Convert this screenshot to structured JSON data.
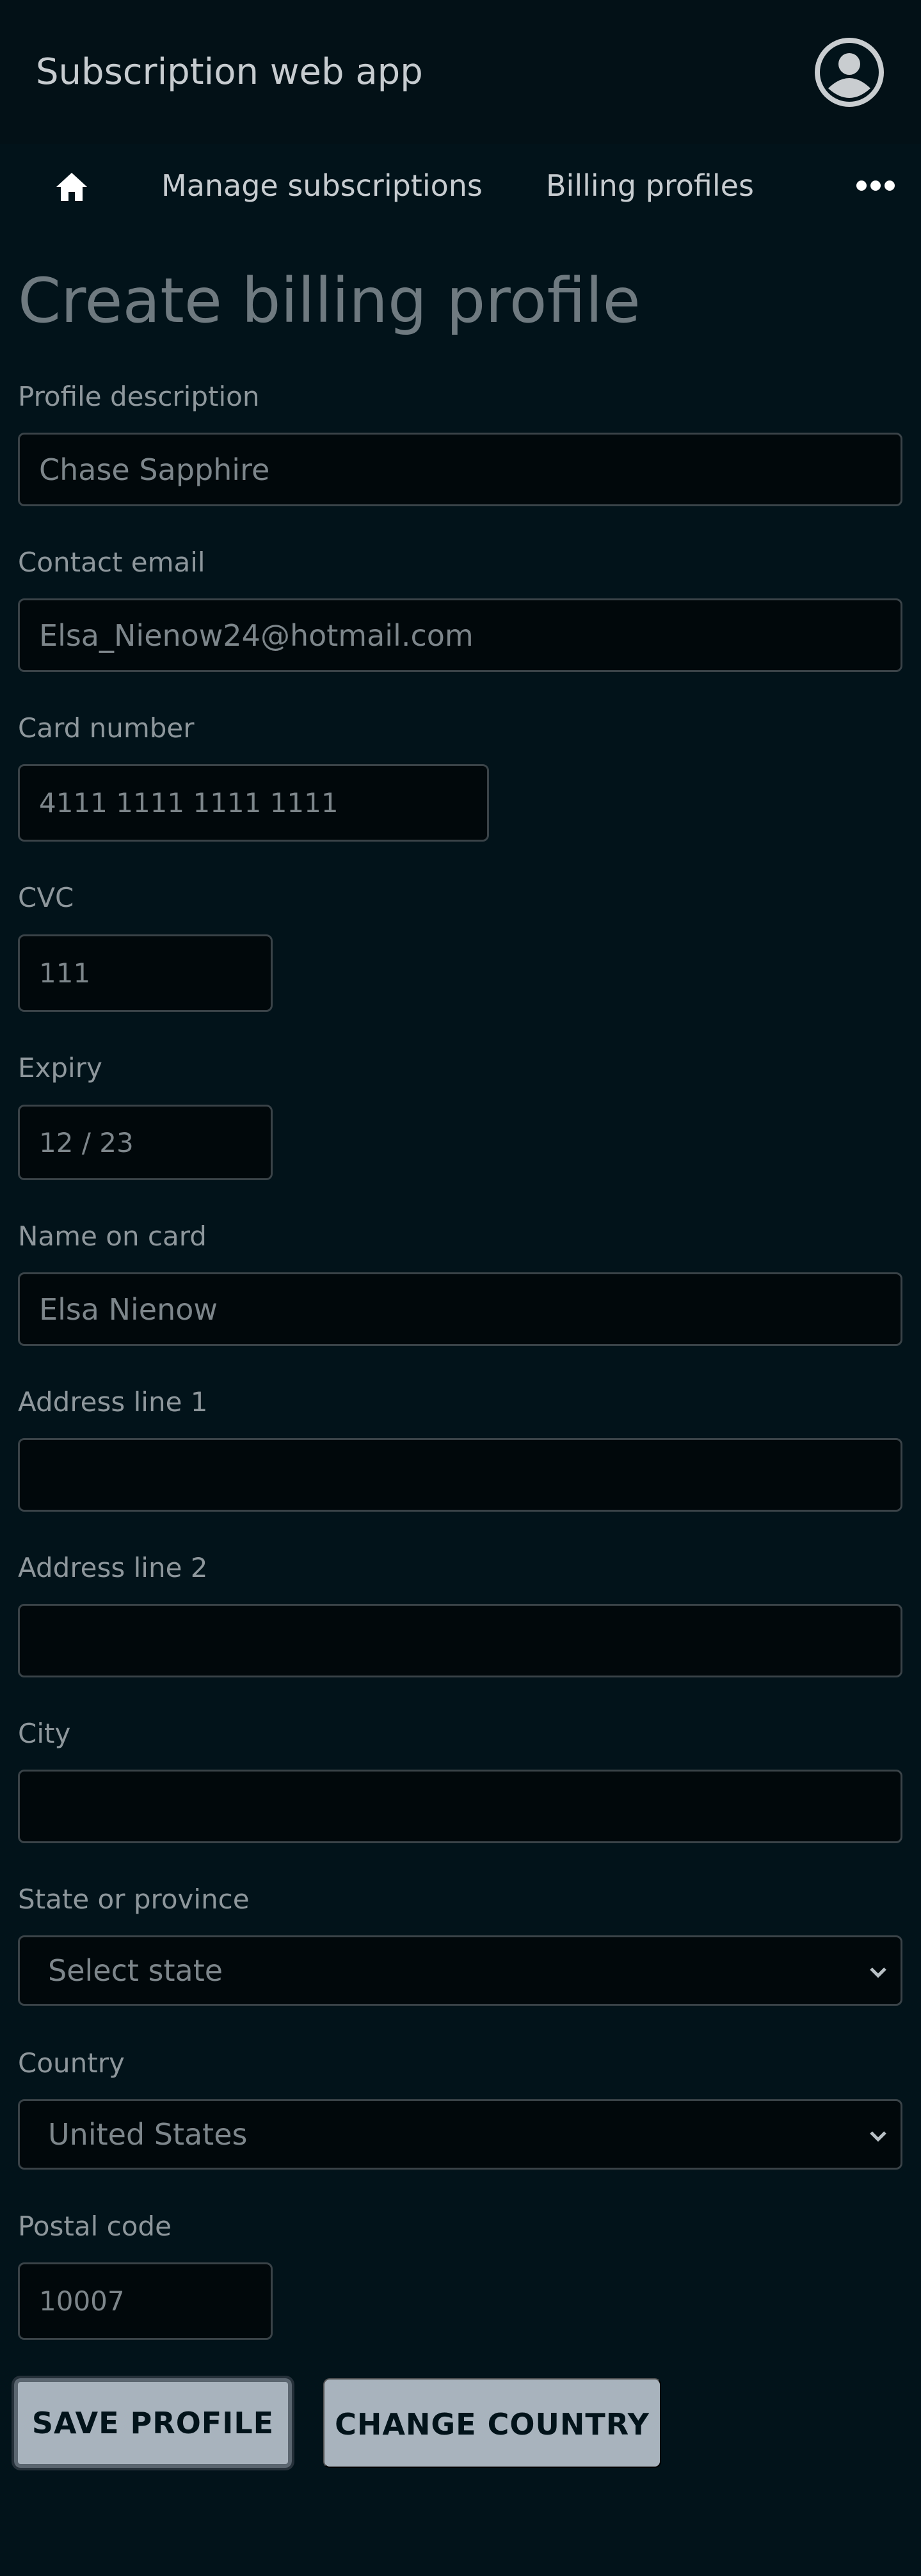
{
  "header": {
    "app_title": "Subscription web app",
    "avatar_icon": "user-circle-icon"
  },
  "nav": {
    "home_icon": "home-icon",
    "links": [
      {
        "label": "Manage subscriptions"
      },
      {
        "label": "Billing profiles"
      }
    ],
    "more_icon": "more-horizontal-icon"
  },
  "page": {
    "title": "Create billing profile"
  },
  "form": {
    "profile_description": {
      "label": "Profile description",
      "value": "Chase Sapphire"
    },
    "contact_email": {
      "label": "Contact email",
      "value": "Elsa_Nienow24@hotmail.com"
    },
    "card_number": {
      "label": "Card number",
      "placeholder": "4111 1111 1111 1111"
    },
    "cvc": {
      "label": "CVC",
      "placeholder": "111"
    },
    "expiry": {
      "label": "Expiry",
      "placeholder": "12 / 23"
    },
    "name_on_card": {
      "label": "Name on card",
      "value": "Elsa Nienow"
    },
    "address_line_1": {
      "label": "Address line 1",
      "value": ""
    },
    "address_line_2": {
      "label": "Address line 2",
      "value": ""
    },
    "city": {
      "label": "City",
      "value": ""
    },
    "state": {
      "label": "State or province",
      "selected": "Select state"
    },
    "country": {
      "label": "Country",
      "selected": "United States"
    },
    "postal_code": {
      "label": "Postal code",
      "placeholder": "10007"
    }
  },
  "actions": {
    "save_label": "SAVE PROFILE",
    "change_country_label": "CHANGE COUNTRY"
  },
  "colors": {
    "background": "#02131a",
    "input_background": "#01080b",
    "button_background": "#a8b3bd"
  }
}
